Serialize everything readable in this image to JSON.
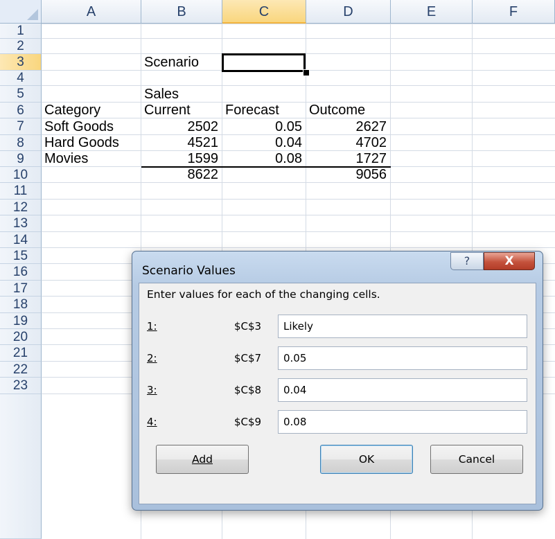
{
  "columns": [
    "A",
    "B",
    "C",
    "D",
    "E",
    "F"
  ],
  "selected_column": "C",
  "rows": [
    "1",
    "2",
    "3",
    "4",
    "5",
    "6",
    "7",
    "8",
    "9",
    "10",
    "11",
    "12",
    "13",
    "14",
    "15",
    "16",
    "17",
    "18",
    "19",
    "20",
    "21",
    "22",
    "23"
  ],
  "selected_row": "3",
  "cells": {
    "B3": "Scenario",
    "B5": "Sales",
    "A6": "Category",
    "B6": "Current",
    "C6": "Forecast",
    "D6": "Outcome",
    "A7": "Soft Goods",
    "B7": "2502",
    "C7": "0.05",
    "D7": "2627",
    "A8": "Hard Goods",
    "B8": "4521",
    "C8": "0.04",
    "D8": "4702",
    "A9": "Movies",
    "B9": "1599",
    "C9": "0.08",
    "D9": "1727",
    "B10": "8622",
    "D10": "9056"
  },
  "dialog": {
    "title": "Scenario Values",
    "help_glyph": "?",
    "close_glyph": "X",
    "instructions": "Enter values for each of the changing cells.",
    "rows": [
      {
        "label": "1:",
        "ref": "$C$3",
        "value": "Likely"
      },
      {
        "label": "2:",
        "ref": "$C$7",
        "value": "0.05"
      },
      {
        "label": "3:",
        "ref": "$C$8",
        "value": "0.04"
      },
      {
        "label": "4:",
        "ref": "$C$9",
        "value": "0.08"
      }
    ],
    "buttons": {
      "add": "Add",
      "ok": "OK",
      "cancel": "Cancel"
    }
  }
}
